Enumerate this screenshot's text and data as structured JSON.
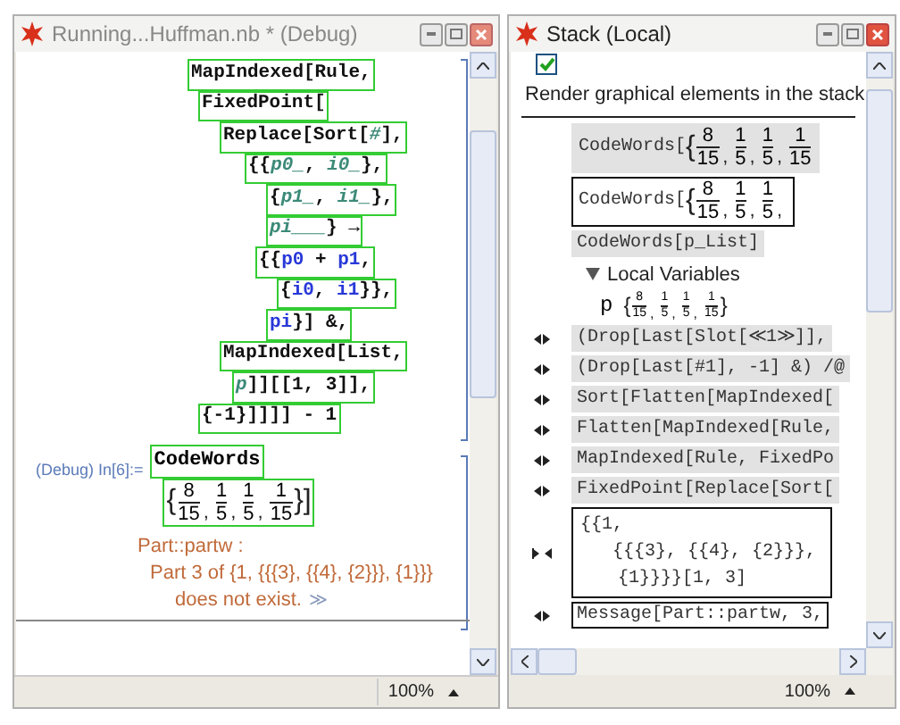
{
  "notebook": {
    "title": "Running...Huffman.nb * (Debug)",
    "code": [
      {
        "parts": [
          {
            "text": "MapIndexed[Rule,",
            "kind": "sym"
          }
        ]
      },
      {
        "parts": [
          {
            "text": "FixedPoint[",
            "kind": "sym"
          }
        ]
      },
      {
        "parts": [
          {
            "text": "Replace[Sort[",
            "kind": "sym"
          },
          {
            "text": "#",
            "kind": "slot"
          },
          {
            "text": "],",
            "kind": "sym"
          }
        ]
      },
      {
        "parts": [
          {
            "text": "{{",
            "kind": "sym"
          },
          {
            "text": "p0_",
            "kind": "pattern"
          },
          {
            "text": ", ",
            "kind": "sym"
          },
          {
            "text": "i0_",
            "kind": "pattern"
          },
          {
            "text": "},",
            "kind": "sym"
          }
        ]
      },
      {
        "parts": [
          {
            "text": "{",
            "kind": "sym"
          },
          {
            "text": "p1_",
            "kind": "pattern"
          },
          {
            "text": ", ",
            "kind": "sym"
          },
          {
            "text": "i1_",
            "kind": "pattern"
          },
          {
            "text": "},",
            "kind": "sym"
          }
        ]
      },
      {
        "parts": [
          {
            "text": "pi___",
            "kind": "pattern"
          },
          {
            "text": "} →",
            "kind": "sym"
          }
        ]
      },
      {
        "parts": [
          {
            "text": "{{",
            "kind": "sym"
          },
          {
            "text": "p0",
            "kind": "local"
          },
          {
            "text": " + ",
            "kind": "sym"
          },
          {
            "text": "p1",
            "kind": "local"
          },
          {
            "text": ",",
            "kind": "sym"
          }
        ]
      },
      {
        "parts": [
          {
            "text": "{",
            "kind": "sym"
          },
          {
            "text": "i0",
            "kind": "local"
          },
          {
            "text": ", ",
            "kind": "sym"
          },
          {
            "text": "i1",
            "kind": "local"
          },
          {
            "text": "}},",
            "kind": "sym"
          }
        ]
      },
      {
        "parts": [
          {
            "text": "pi",
            "kind": "local"
          },
          {
            "text": "}] &,",
            "kind": "sym"
          }
        ]
      },
      {
        "parts": [
          {
            "text": "MapIndexed[List,",
            "kind": "sym"
          }
        ]
      },
      {
        "parts": [
          {
            "text": "p",
            "kind": "pattern"
          },
          {
            "text": "]][[1, 3]],",
            "kind": "sym"
          }
        ]
      },
      {
        "parts": [
          {
            "text": "{-1}]]]] - 1",
            "kind": "sym"
          }
        ]
      }
    ],
    "input_label": "(Debug) In[6]:=",
    "input": {
      "head": "CodeWords",
      "tokens": [
        {
          "kind": "brace",
          "text": "{"
        },
        {
          "kind": "frac",
          "num": "8",
          "den": "15",
          "sep": ","
        },
        {
          "kind": "frac",
          "num": "1",
          "den": "5",
          "sep": ","
        },
        {
          "kind": "frac",
          "num": "1",
          "den": "5",
          "sep": ","
        },
        {
          "kind": "frac",
          "num": "1",
          "den": "15"
        },
        {
          "kind": "brace",
          "text": "}]"
        }
      ]
    },
    "message": {
      "name": "Part::partw :",
      "lines": [
        "Part 3 of {1, {{{3}, {{4}, {2}}}, {1}}}",
        "does not exist."
      ],
      "link": "≫"
    },
    "zoom": "100%"
  },
  "stack": {
    "title": "Stack (Local)",
    "render_graphics": {
      "label": "Render graphical elements in the stack",
      "checked": true
    },
    "items": [
      {
        "kind": "call",
        "head": "CodeWords[",
        "tokens": [
          {
            "kind": "brace",
            "text": "{"
          },
          {
            "kind": "frac",
            "num": "8",
            "den": "15",
            "sep": ","
          },
          {
            "kind": "frac",
            "num": "1",
            "den": "5",
            "sep": ","
          },
          {
            "kind": "frac",
            "num": "1",
            "den": "5",
            "sep": ","
          },
          {
            "kind": "frac",
            "num": "1",
            "den": "15"
          }
        ],
        "selected": false
      },
      {
        "kind": "call",
        "head": "CodeWords[",
        "tokens": [
          {
            "kind": "brace",
            "text": "{"
          },
          {
            "kind": "frac",
            "num": "8",
            "den": "15",
            "sep": ","
          },
          {
            "kind": "frac",
            "num": "1",
            "den": "5",
            "sep": ","
          },
          {
            "kind": "frac",
            "num": "1",
            "den": "5",
            "sep": ","
          }
        ],
        "selected": true
      },
      {
        "kind": "function",
        "text": "CodeWords[p_List]",
        "selected": false
      },
      {
        "kind": "locals",
        "label": "Local Variables",
        "expanded": true,
        "variables": [
          {
            "name": "p",
            "tokens": [
              {
                "kind": "brace",
                "text": "{"
              },
              {
                "kind": "frac",
                "num": "8",
                "den": "15",
                "sep": ","
              },
              {
                "kind": "frac",
                "num": "1",
                "den": "5",
                "sep": ","
              },
              {
                "kind": "frac",
                "num": "1",
                "den": "5",
                "sep": ","
              },
              {
                "kind": "frac",
                "num": "1",
                "den": "15"
              },
              {
                "kind": "brace",
                "text": "}"
              }
            ]
          }
        ]
      },
      {
        "kind": "expr",
        "text": "(Drop[Last[Slot[≪1≫]],",
        "selected": false
      },
      {
        "kind": "expr",
        "text": "(Drop[Last[#1], -1] &) /@",
        "selected": false
      },
      {
        "kind": "expr",
        "text": "Sort[Flatten[MapIndexed[",
        "selected": false
      },
      {
        "kind": "expr",
        "text": "Flatten[MapIndexed[Rule,",
        "selected": false
      },
      {
        "kind": "expr",
        "text": "MapIndexed[Rule, FixedPo",
        "selected": false
      },
      {
        "kind": "expr",
        "text": "FixedPoint[Replace[Sort[",
        "selected": false
      },
      {
        "kind": "result",
        "lines": [
          "{{1,",
          "{{{3}, {{4}, {2}}},",
          "{1}}}}[1, 3]"
        ],
        "selected": true
      },
      {
        "kind": "expr",
        "text": "Message[Part::partw, 3,",
        "selected": true
      }
    ],
    "zoom": "100%"
  }
}
